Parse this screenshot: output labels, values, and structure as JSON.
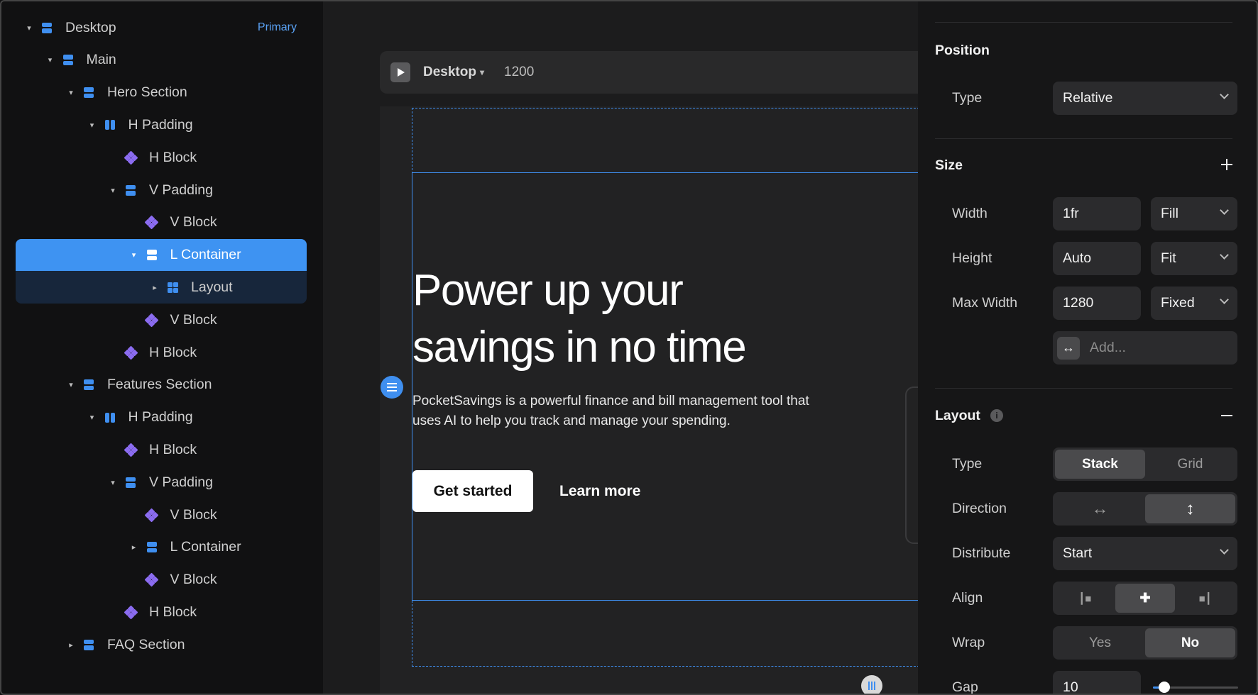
{
  "layers": {
    "items": [
      {
        "label": "Desktop",
        "icon": "stack-icon",
        "caret": "down",
        "depth": 0,
        "tag": "Primary"
      },
      {
        "label": "Main",
        "icon": "stack-icon",
        "caret": "down",
        "depth": 1
      },
      {
        "label": "Hero Section",
        "icon": "stack-icon",
        "caret": "down",
        "depth": 2
      },
      {
        "label": "H Padding",
        "icon": "hstack-icon",
        "caret": "down",
        "depth": 3
      },
      {
        "label": "H Block",
        "icon": "component-icon",
        "caret": "none",
        "depth": 4
      },
      {
        "label": "V Padding",
        "icon": "stack-icon",
        "caret": "down",
        "depth": 4
      },
      {
        "label": "V Block",
        "icon": "component-icon",
        "caret": "none",
        "depth": 5
      },
      {
        "label": "L Container",
        "icon": "stack-icon",
        "caret": "down",
        "depth": 5,
        "state": "selected"
      },
      {
        "label": "Layout",
        "icon": "grid-icon",
        "caret": "right",
        "depth": 6,
        "state": "selected-child"
      },
      {
        "label": "V Block",
        "icon": "component-icon",
        "caret": "none",
        "depth": 5
      },
      {
        "label": "H Block",
        "icon": "component-icon",
        "caret": "none",
        "depth": 4
      },
      {
        "label": "Features Section",
        "icon": "stack-icon",
        "caret": "down",
        "depth": 2
      },
      {
        "label": "H Padding",
        "icon": "hstack-icon",
        "caret": "down",
        "depth": 3
      },
      {
        "label": "H Block",
        "icon": "component-icon",
        "caret": "none",
        "depth": 4
      },
      {
        "label": "V Padding",
        "icon": "stack-icon",
        "caret": "down",
        "depth": 4
      },
      {
        "label": "V Block",
        "icon": "component-icon",
        "caret": "none",
        "depth": 5
      },
      {
        "label": "L Container",
        "icon": "stack-icon",
        "caret": "right",
        "depth": 5
      },
      {
        "label": "V Block",
        "icon": "component-icon",
        "caret": "none",
        "depth": 5
      },
      {
        "label": "H Block",
        "icon": "component-icon",
        "caret": "none",
        "depth": 4
      },
      {
        "label": "FAQ Section",
        "icon": "stack-icon",
        "caret": "right",
        "depth": 2
      }
    ]
  },
  "canvas": {
    "breakpoint": "Desktop",
    "width": "1200",
    "hero_title_line1": "Power up your",
    "hero_title_line2": "savings in no time",
    "hero_desc_line1": "PocketSavings is a powerful finance and bill management tool that",
    "hero_desc_line2": "uses AI to help you track and manage your spending.",
    "primary_button": "Get started",
    "secondary_button": "Learn more"
  },
  "properties": {
    "position": {
      "title": "Position",
      "type_label": "Type",
      "type_value": "Relative"
    },
    "size": {
      "title": "Size",
      "width_label": "Width",
      "width_value": "1fr",
      "width_mode": "Fill",
      "height_label": "Height",
      "height_value": "Auto",
      "height_mode": "Fit",
      "max_width_label": "Max Width",
      "max_width_value": "1280",
      "max_width_mode": "Fixed",
      "add_placeholder": "Add..."
    },
    "layout": {
      "title": "Layout",
      "type_label": "Type",
      "type_options": [
        "Stack",
        "Grid"
      ],
      "type_active": "Stack",
      "direction_label": "Direction",
      "direction_active": "vertical",
      "distribute_label": "Distribute",
      "distribute_value": "Start",
      "align_label": "Align",
      "align_active": "center",
      "wrap_label": "Wrap",
      "wrap_options": [
        "Yes",
        "No"
      ],
      "wrap_active": "No",
      "gap_label": "Gap",
      "gap_value": "10",
      "gap_slider_fraction": 0.13
    }
  },
  "colors": {
    "accent": "#3e93f2",
    "component": "#8b6cf0",
    "panel": "#161617",
    "canvas": "#1c1c1d"
  }
}
